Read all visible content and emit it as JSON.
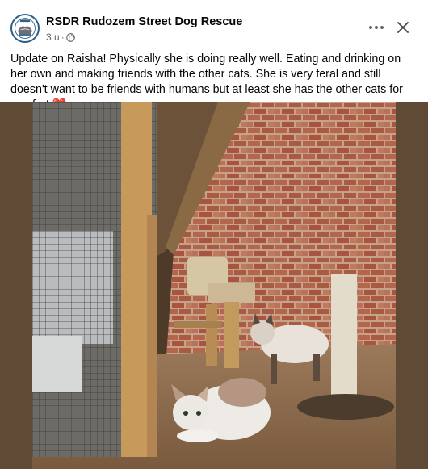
{
  "post": {
    "page_name": "RSDR Rudozem Street Dog Rescue",
    "time": "3 u",
    "dot": "·",
    "text": "Update on Raisha! Physically she is doing really well. Eating and drinking on her own and making friends with the other cats. She is very feral and still doesn't want to be friends with humans but at least she has the other cats for comfort",
    "emoji": "❤️",
    "icons": {
      "audience": "globe-icon",
      "more": "more-options-icon",
      "close": "close-icon"
    }
  },
  "colors": {
    "text": "#050505",
    "secondary_text": "#65676b",
    "heart": "#e41e3f",
    "avatar_ring": "#2c5f86"
  }
}
